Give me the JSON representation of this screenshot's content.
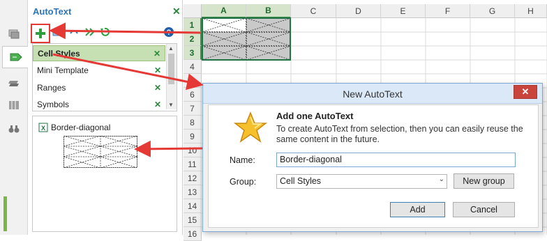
{
  "pane": {
    "title": "AutoText",
    "list_items": [
      "Cell Styles",
      "Mini Template",
      "Ranges",
      "Symbols"
    ],
    "selected_item": "Cell Styles",
    "preview_title": "Border-diagonal",
    "toolbar_icons": [
      "add-icon",
      "edit-icon",
      "refresh-icon",
      "undo-icon",
      "help-icon"
    ]
  },
  "sheet": {
    "columns": [
      "A",
      "B",
      "C",
      "D",
      "E",
      "F",
      "G",
      "H"
    ],
    "rows": [
      "1",
      "2",
      "3",
      "4",
      "5",
      "6",
      "7",
      "8",
      "9",
      "10",
      "11",
      "12",
      "13",
      "14",
      "15",
      "16"
    ],
    "selected_columns": [
      "A",
      "B"
    ],
    "selected_rows": [
      "1",
      "2",
      "3"
    ]
  },
  "dialog": {
    "title": "New AutoText",
    "heading": "Add one AutoText",
    "description": "To create AutoText from selection, then you can easily reuse the same content in the future.",
    "name_label": "Name:",
    "name_value": "Border-diagonal",
    "group_label": "Group:",
    "group_value": "Cell Styles",
    "new_group_label": "New group",
    "add_label": "Add",
    "cancel_label": "Cancel",
    "close_symbol": "✕"
  },
  "colors": {
    "accent_green": "#217346",
    "arrow_red": "#e53935",
    "title_blue": "#2e75b6"
  }
}
